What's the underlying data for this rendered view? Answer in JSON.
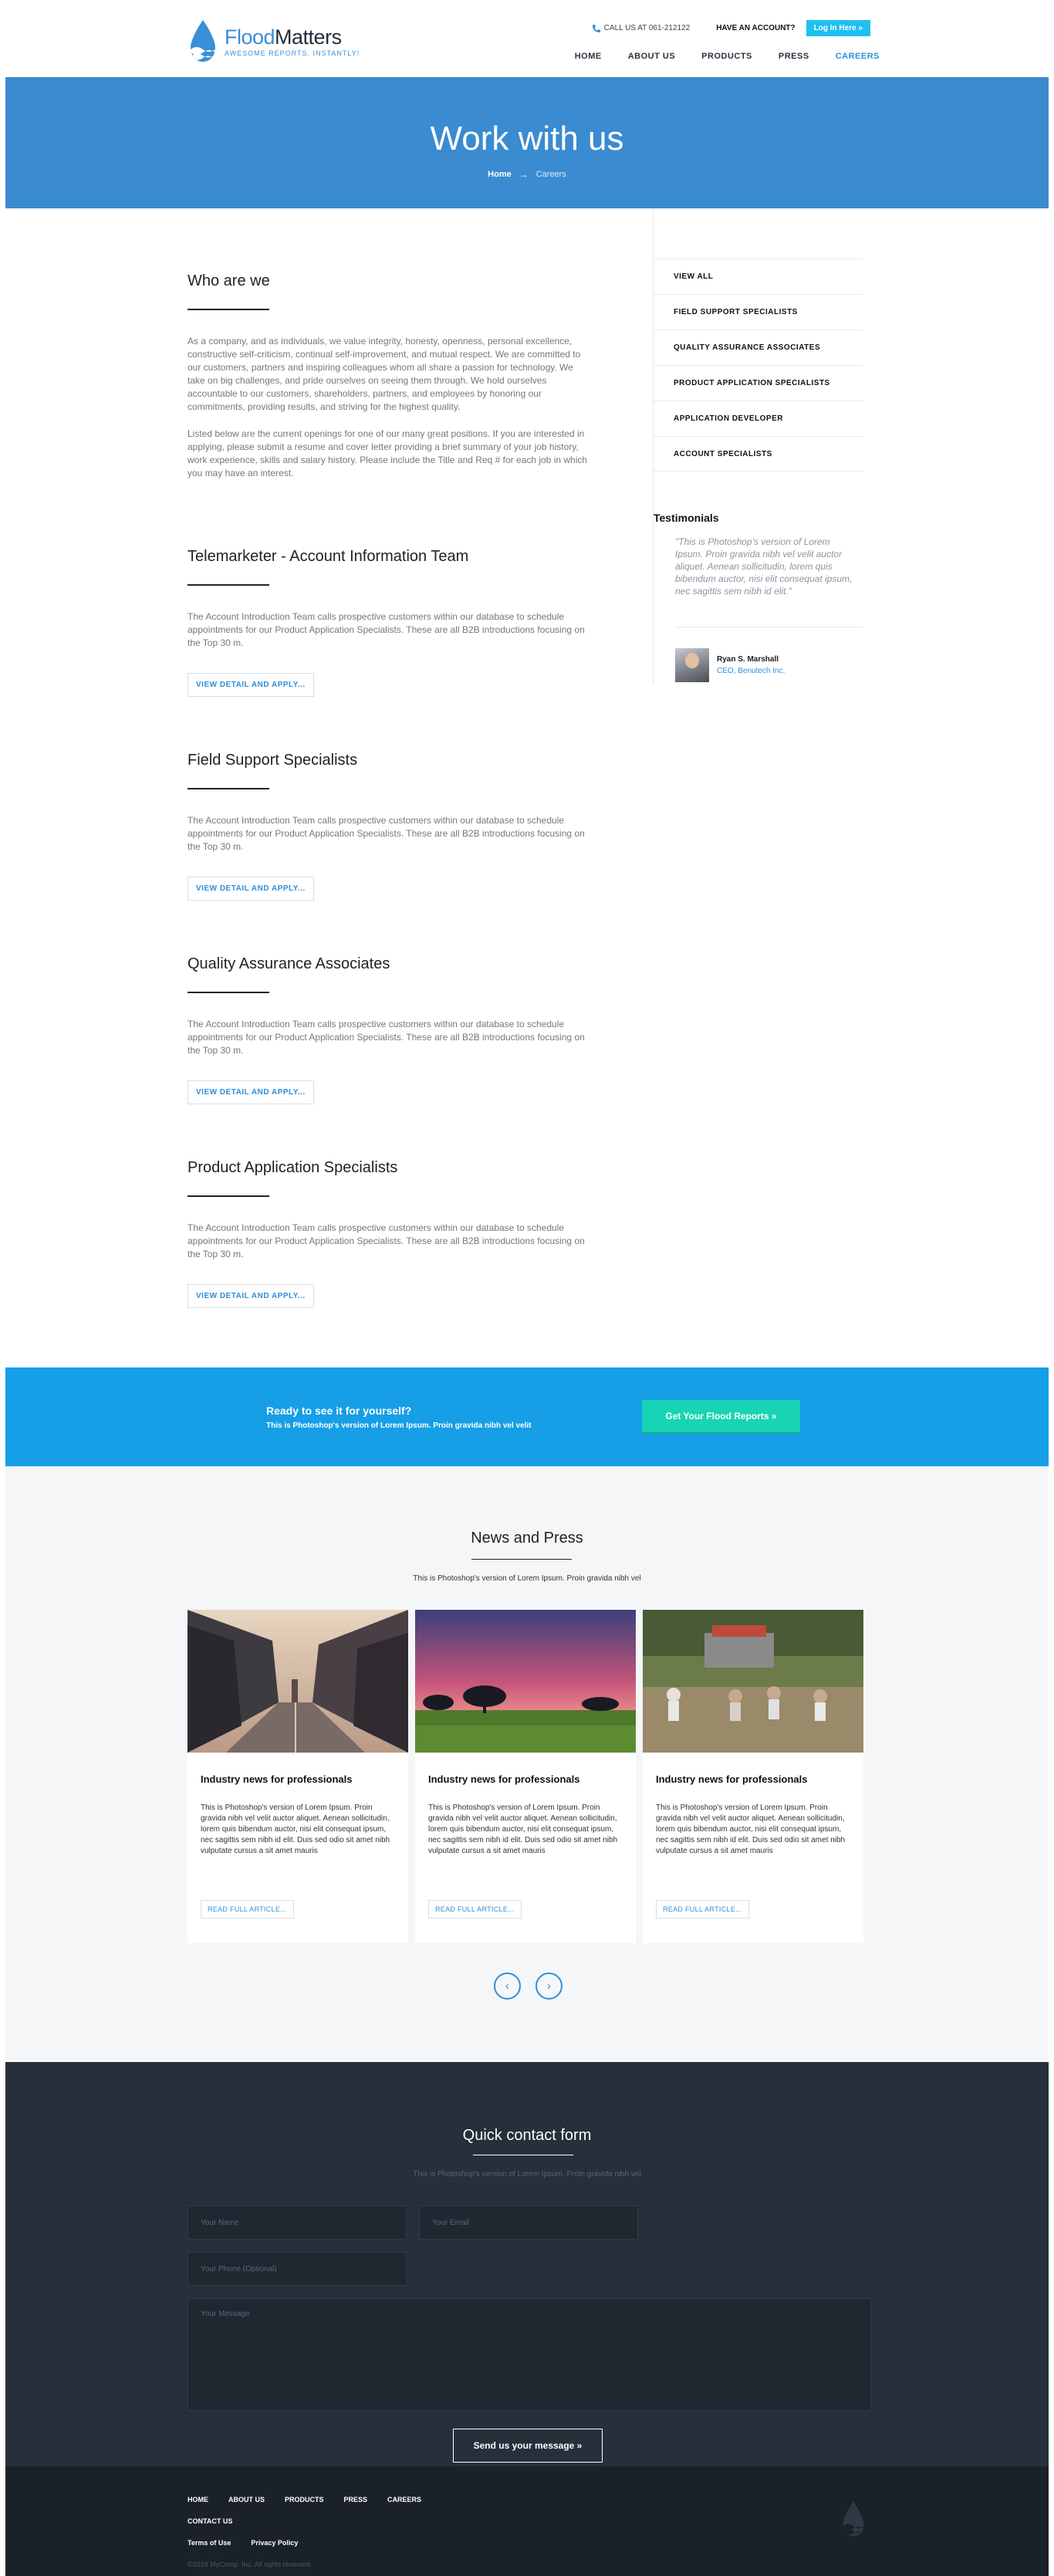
{
  "brand": {
    "name_part1": "Flood",
    "name_part2": "Matters",
    "tagline": "AWESOME REPORTS. INSTANTLY!"
  },
  "topbar": {
    "call": "CALL US AT 061-212122",
    "have_account": "HAVE AN ACCOUNT?",
    "login": "Log In Here »"
  },
  "nav": [
    "HOME",
    "ABOUT US",
    "PRODUCTS",
    "PRESS",
    "CAREERS"
  ],
  "hero": {
    "title": "Work with us",
    "crumb_home": "Home",
    "crumb_arrow": "→",
    "crumb_current": "Careers"
  },
  "who": {
    "title": "Who are we",
    "p1": "As a company, and as individuals, we value integrity, honesty, openness, personal excellence, constructive self-criticism, continual self-improvement, and mutual respect. We are committed to our customers, partners and inspiring colleagues whom all share a passion for technology. We take on big challenges, and pride ourselves on seeing them through. We hold ourselves accountable to our customers, shareholders, partners, and employees by honoring our commitments, providing results, and striving for the highest quality.",
    "p2": "Listed below are the current openings for one of our many great positions. If you are interested in applying, please submit a resume and cover letter providing a brief summary of your job history, work experience, skills and salary history. Please include the Title and Req # for each job in which you may have an interest."
  },
  "jobs": [
    {
      "title": "Telemarketer - Account Information Team",
      "desc": "The Account Introduction Team calls prospective customers within our database to schedule appointments for our Product Application Specialists. These are all B2B introductions focusing on the Top 30 m.",
      "button": "VIEW DETAIL AND APPLY..."
    },
    {
      "title": "Field Support Specialists",
      "desc": "The Account Introduction Team calls prospective customers within our database to schedule appointments for our Product Application Specialists. These are all B2B introductions focusing on the Top 30 m.",
      "button": "VIEW DETAIL AND APPLY..."
    },
    {
      "title": "Quality Assurance Associates",
      "desc": "The Account Introduction Team calls prospective customers within our database to schedule appointments for our Product Application Specialists. These are all B2B introductions focusing on the Top 30 m.",
      "button": "VIEW DETAIL AND APPLY..."
    },
    {
      "title": "Product Application Specialists",
      "desc": "The Account Introduction Team calls prospective customers within our database to schedule appointments for our Product Application Specialists. These are all B2B introductions focusing on the Top 30 m.",
      "button": "VIEW DETAIL AND APPLY..."
    }
  ],
  "sidebar": {
    "categories": [
      "VIEW ALL",
      "FIELD SUPPORT SPECIALISTS",
      "QUALITY ASSURANCE ASSOCIATES",
      "PRODUCT APPLICATION SPECIALISTS",
      "APPLICATION DEVELOPER",
      "ACCOUNT SPECIALISTS"
    ],
    "testimonials_title": "Testimonials",
    "quote": "\"This is Photoshop's version of Lorem Ipsum. Proin gravida nibh vel velit auctor aliquet. Aenean sollicitudin, lorem quis bibendum auctor, nisi elit consequat ipsum, nec sagittis sem nibh id elit.\"",
    "person_name": "Ryan S. Marshall",
    "person_role": "CEO, Benutech Inc."
  },
  "cta": {
    "title": "Ready to see it for yourself?",
    "subtitle": "This is Photoshop's version of Lorem Ipsum. Proin gravida nibh vel velit",
    "button": "Get Your Flood Reports »"
  },
  "news": {
    "title": "News and Press",
    "subtitle": "This is Photoshop's version of Lorem Ipsum. Proin gravida nibh vel",
    "cards": [
      {
        "title": "Industry news for professionals",
        "text": "This is Photoshop's version of Lorem Ipsum. Proin gravida nibh vel velit auctor aliquet. Aenean sollicitudin, lorem quis bibendum auctor, nisi elit consequat ipsum, nec sagittis sem nibh id elit. Duis sed odio sit amet nibh vulputate cursus a sit amet mauris",
        "button": "READ FULL ARTICLE..."
      },
      {
        "title": "Industry news for professionals",
        "text": "This is Photoshop's version of Lorem Ipsum. Proin gravida nibh vel velit auctor aliquet. Aenean sollicitudin, lorem quis bibendum auctor, nisi elit consequat ipsum, nec sagittis sem nibh id elit. Duis sed odio sit amet nibh vulputate cursus a sit amet mauris",
        "button": "READ FULL ARTICLE..."
      },
      {
        "title": "Industry news for professionals",
        "text": "This is Photoshop's version of Lorem Ipsum. Proin gravida nibh vel velit auctor aliquet. Aenean sollicitudin, lorem quis bibendum auctor, nisi elit consequat ipsum, nec sagittis sem nibh id elit. Duis sed odio sit amet nibh vulputate cursus a sit amet mauris",
        "button": "READ FULL ARTICLE..."
      }
    ],
    "prev": "‹",
    "next": "›"
  },
  "contact": {
    "title": "Quick contact form",
    "subtitle": "This is Photoshop's version of Lorem Ipsum. Proin gravida nibh vel",
    "name_placeholder": "Your Name",
    "email_placeholder": "Your Email",
    "phone_placeholder": "Your Phone (Optional)",
    "message_placeholder": "Your Message",
    "send": "Send us your message »"
  },
  "footer": {
    "links_row1": [
      "HOME",
      "ABOUT US",
      "PRODUCTS",
      "PRESS",
      "CAREERS"
    ],
    "links_row2": [
      "CONTACT US"
    ],
    "links_row3": [
      "Terms of Use",
      "Privacy Policy"
    ],
    "copyright": "©2016 MyComp. Inc. All rights reserved."
  },
  "colors": {
    "accent": "#2e8fd8",
    "hero": "#3a8bd0",
    "cta": "#169ee6",
    "cta_button": "#18d4b4",
    "login": "#1ec0f0",
    "contact_bg": "#262f3a",
    "footer_bg": "#1b2129"
  }
}
